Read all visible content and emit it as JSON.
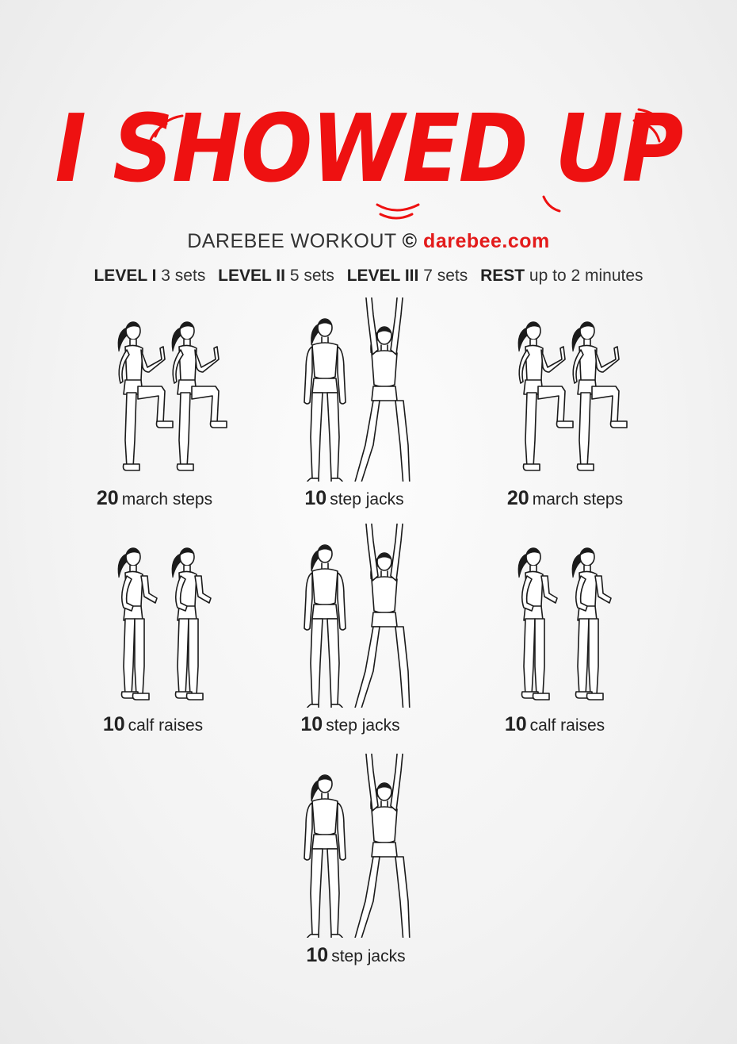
{
  "title": "I SHOWED UP",
  "subtitle": {
    "brand": "DAREBEE WORKOUT",
    "copyright": "©",
    "site": "darebee.com"
  },
  "levels": [
    {
      "label": "LEVEL I",
      "value": "3 sets"
    },
    {
      "label": "LEVEL II",
      "value": "5 sets"
    },
    {
      "label": "LEVEL III",
      "value": "7 sets"
    },
    {
      "label": "REST",
      "value": "up to 2 minutes"
    }
  ],
  "exercises": [
    {
      "count": "20",
      "name": "march steps",
      "kind": "march"
    },
    {
      "count": "10",
      "name": "step jacks",
      "kind": "jacks"
    },
    {
      "count": "20",
      "name": "march steps",
      "kind": "march"
    },
    {
      "count": "10",
      "name": "calf raises",
      "kind": "calf"
    },
    {
      "count": "10",
      "name": "step jacks",
      "kind": "jacks"
    },
    {
      "count": "10",
      "name": "calf raises",
      "kind": "calf"
    },
    {
      "count": "10",
      "name": "step jacks",
      "kind": "jacks"
    }
  ],
  "colors": {
    "accent": "#ee1111",
    "link": "#e31b1b",
    "text": "#222222"
  }
}
